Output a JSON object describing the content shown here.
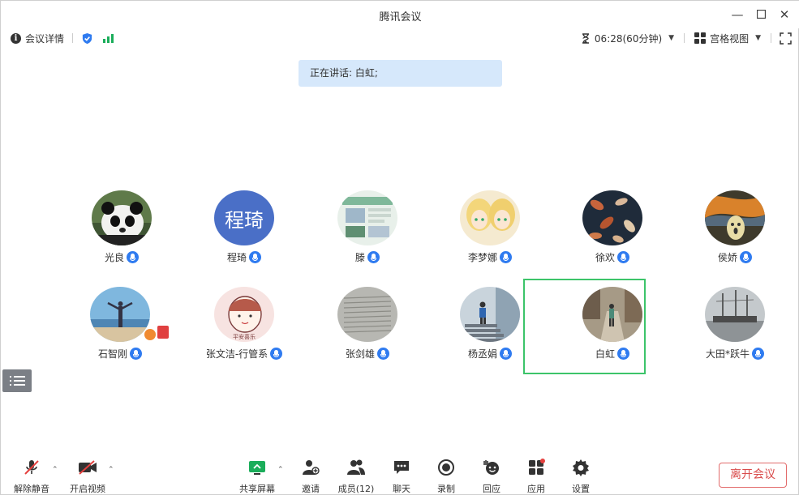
{
  "window": {
    "title": "腾讯会议",
    "minimize_icon": "minimize-icon",
    "maximize_icon": "maximize-icon",
    "close_icon": "close-icon"
  },
  "infobar": {
    "details_label": "会议详情",
    "timer": "06:28(60分钟)",
    "view_label": "宫格视图",
    "colors": {
      "shield": "#2f7bf0",
      "signal": "#1aad5a"
    }
  },
  "speaking": {
    "text": "正在讲话: 白虹;"
  },
  "participants": [
    {
      "name": "光良",
      "avatar": "panda-photo"
    },
    {
      "name": "程琦",
      "avatar": "text-avatar",
      "avatar_text": "程琦",
      "avatar_color": "#4a6fc7"
    },
    {
      "name": "滕",
      "avatar": "document-photo"
    },
    {
      "name": "李梦娜",
      "avatar": "anime-photo"
    },
    {
      "name": "徐欢",
      "avatar": "floral-photo"
    },
    {
      "name": "侯娇",
      "avatar": "painting-photo"
    },
    {
      "name": "石智刚",
      "avatar": "beach-photo"
    },
    {
      "name": "张文洁-行管系",
      "avatar": "cartoon-girl-photo",
      "avatar_caption": "平安喜乐"
    },
    {
      "name": "张剑雄",
      "avatar": "paper-photo"
    },
    {
      "name": "杨丞娟",
      "avatar": "stairs-photo"
    },
    {
      "name": "白虹",
      "avatar": "street-photo",
      "selected": true
    },
    {
      "name": "大田*跃牛",
      "avatar": "ship-photo"
    }
  ],
  "toolbar": {
    "unmute": "解除静音",
    "start_video": "开启视频",
    "share_screen": "共享屏幕",
    "invite": "邀请",
    "members": "成员(12)",
    "chat": "聊天",
    "record": "录制",
    "react": "回应",
    "apps": "应用",
    "settings": "设置",
    "leave": "离开会议",
    "colors": {
      "leave": "#d94c4c",
      "share": "#1aad5a",
      "muted": "#e5413f"
    }
  }
}
